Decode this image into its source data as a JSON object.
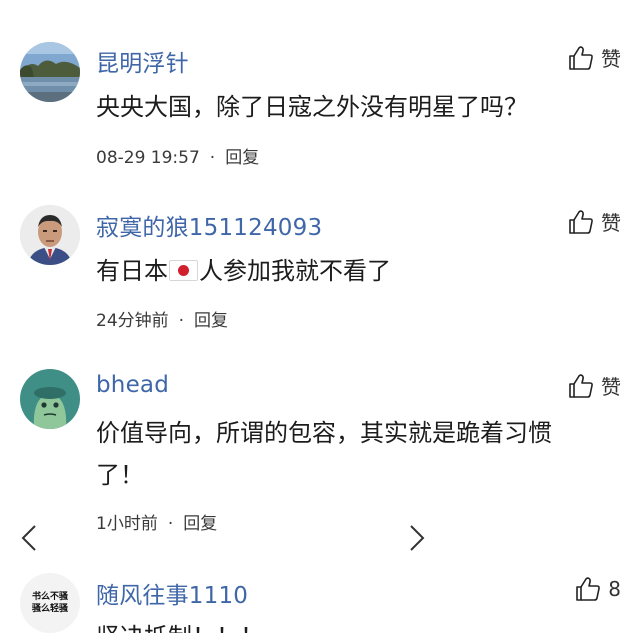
{
  "comments": [
    {
      "username": "昆明浮针",
      "text": "央央大国，除了日寇之外没有明星了吗？",
      "time": "08-29 19:57",
      "reply_label": "回复",
      "like_label": "赞"
    },
    {
      "username": "寂寞的狼151124093",
      "text_before_flag": "有日本",
      "text_after_flag": "人参加我就不看了",
      "time": "24分钟前",
      "reply_label": "回复",
      "like_label": "赞"
    },
    {
      "username": "bhead",
      "text": "价值导向，所谓的包容，其实就是跪着习惯了！",
      "time": "1小时前",
      "reply_label": "回复",
      "like_label": "赞"
    },
    {
      "username": "随风往事1110",
      "text": "坚决抵制！！！",
      "like_count": "8",
      "avatar_text_line1": "书么不骚",
      "avatar_text_line2": "骚么轻骚"
    }
  ],
  "separator": "·",
  "icons": {
    "like": "thumbs-up-icon",
    "flag": "japan-flag-icon",
    "prev": "chevron-left-icon",
    "next": "chevron-right-icon"
  },
  "colors": {
    "username": "#3f67a8",
    "text": "#1c1c1c",
    "meta": "#3a3a3a",
    "flag_red": "#d21f2e"
  }
}
